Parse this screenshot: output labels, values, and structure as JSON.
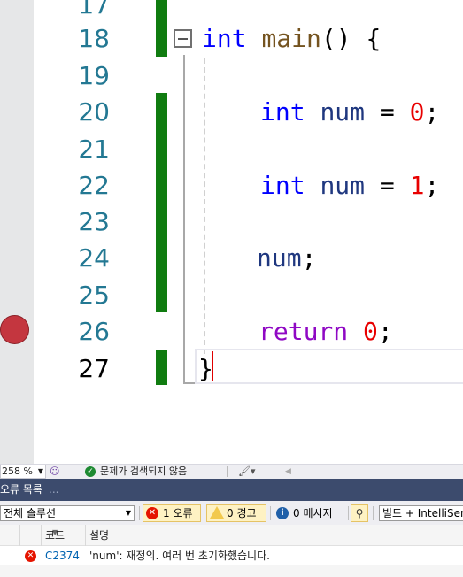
{
  "editor": {
    "line_numbers": [
      "17",
      "18",
      "19",
      "20",
      "21",
      "22",
      "23",
      "24",
      "25",
      "26",
      "27"
    ],
    "active_line": "27",
    "code": {
      "line18": {
        "kw": "int",
        "fn": "main",
        "rest": "() {"
      },
      "line20": {
        "kw": "int",
        "var": "num",
        "op": " = ",
        "num": "0",
        "end": ";"
      },
      "line22": {
        "kw": "int",
        "var": "num",
        "op": " = ",
        "num": "1",
        "end": ";"
      },
      "line24": {
        "var": "num",
        "end": ";"
      },
      "line26": {
        "kw": "return",
        "num": "0",
        "end": ";"
      },
      "line27": {
        "brace": "}"
      }
    }
  },
  "statusbar": {
    "zoom": "258 %",
    "message": "문제가 검색되지 않음"
  },
  "error_list": {
    "title": "오류 목록",
    "title_suffix": "...",
    "scope": "전체 솔루션",
    "errors_button": "1 오류",
    "warnings_button": "0 경고",
    "messages_button": "0 메시지",
    "source": "빌드 + IntelliSense",
    "columns": {
      "code": "코드",
      "description": "설명"
    },
    "rows": [
      {
        "code": "C2374",
        "description": "'num': 재정의. 여러 번 초기화했습니다."
      }
    ]
  },
  "colors": {
    "keyword": "#0000ff",
    "control_keyword": "#8f08c4",
    "function": "#74531f",
    "variable": "#1f377f",
    "number": "#e80000",
    "change_bar": "#107c10",
    "breakpoint": "#c4363f",
    "panel_title_bg": "#3c4b6d"
  },
  "icons": [
    "breakpoint-icon",
    "fold-collapse-icon",
    "check-circle-icon",
    "error-icon",
    "warning-icon",
    "info-icon",
    "filter-icon",
    "brush-icon"
  ]
}
